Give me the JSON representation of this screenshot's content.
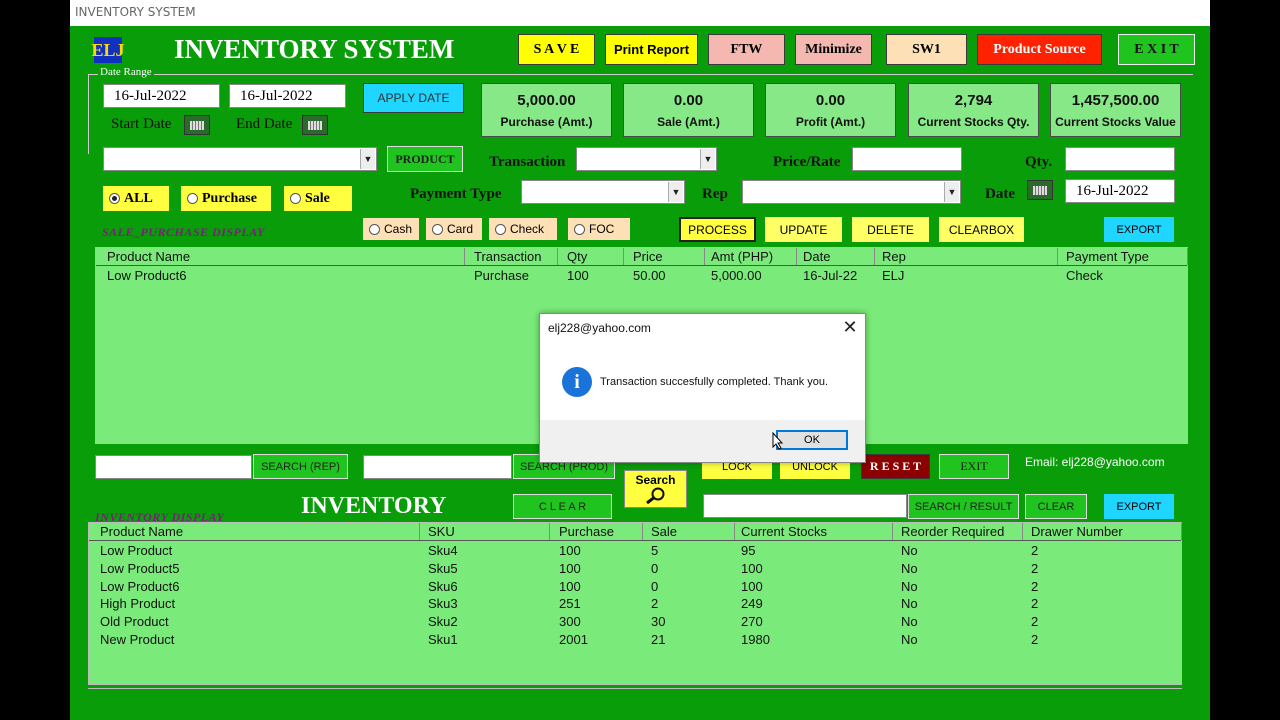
{
  "window": {
    "title": "INVENTORY SYSTEM"
  },
  "header": {
    "logo": "ELJ",
    "title": "INVENTORY SYSTEM",
    "buttons": [
      {
        "label": "S A V E",
        "color": "#ffff00"
      },
      {
        "label": "Print Report",
        "color": "#ffff00"
      },
      {
        "label": "FTW",
        "color": "#f4b8b0"
      },
      {
        "label": "Minimize",
        "color": "#f4b8b0"
      },
      {
        "label": "SW1",
        "color": "#fde0b5"
      },
      {
        "label": "Product Source",
        "color": "#ff2200"
      },
      {
        "label": "E X I T",
        "color": "#1fc41f"
      }
    ]
  },
  "date_range": {
    "legend": "Date Range",
    "start_value": "16-Jul-2022",
    "end_value": "16-Jul-2022",
    "start_label": "Start Date",
    "end_label": "End Date",
    "apply_label": "APPLY DATE"
  },
  "stats": [
    {
      "value": "5,000.00",
      "label": "Purchase (Amt.)"
    },
    {
      "value": "0.00",
      "label": "Sale (Amt.)"
    },
    {
      "value": "0.00",
      "label": "Profit (Amt.)"
    },
    {
      "value": "2,794",
      "label": "Current Stocks Qty."
    },
    {
      "value": "1,457,500.00",
      "label": "Current Stocks Value"
    }
  ],
  "form": {
    "product_button": "PRODUCT",
    "transaction_label": "Transaction",
    "price_label": "Price/Rate",
    "qty_label": "Qty.",
    "payment_type_label": "Payment Type",
    "rep_label": "Rep",
    "date_label": "Date",
    "date_value": "16-Jul-2022",
    "filters": [
      "ALL",
      "Purchase",
      "Sale"
    ],
    "payments": [
      "Cash",
      "Card",
      "Check",
      "FOC"
    ],
    "actions": [
      "PROCESS",
      "UPDATE",
      "DELETE",
      "CLEARBOX"
    ],
    "export_label": "EXPORT"
  },
  "sale_purchase": {
    "caption": "SALE_PURCHASE  DISPLAY",
    "columns": [
      "Product Name",
      "Transaction",
      "Qty",
      "Price",
      "Amt (PHP)",
      "Date",
      "Rep",
      "Payment Type"
    ],
    "rows": [
      [
        "Low Product6",
        "Purchase",
        "100",
        "50.00",
        "5,000.00",
        "16-Jul-22",
        "ELJ",
        "Check"
      ]
    ]
  },
  "search_bar": {
    "search_rep": "SEARCH (REP)",
    "search_prod": "SEARCH (PROD)",
    "lock": "LOCK",
    "unlock": "UNLOCK",
    "reset": "R E S E T",
    "exit": "EXIT",
    "email": "Email:  elj228@yahoo.com"
  },
  "inventory": {
    "caption": "INVENTORY  DISPLAY",
    "title": "INVENTORY",
    "clear_label": "C L E A R",
    "search_label": "Search",
    "search_result": "SEARCH / RESULT",
    "clear2": "CLEAR",
    "export": "EXPORT",
    "columns": [
      "Product Name",
      "SKU",
      "Purchase",
      "Sale",
      "Current Stocks",
      "Reorder Required",
      "Drawer Number"
    ],
    "rows": [
      [
        "Low Product",
        "Sku4",
        "100",
        "5",
        "95",
        "No",
        "2"
      ],
      [
        "Low Product5",
        "Sku5",
        "100",
        "0",
        "100",
        "No",
        "2"
      ],
      [
        "Low Product6",
        "Sku6",
        "100",
        "0",
        "100",
        "No",
        "2"
      ],
      [
        "High Product",
        "Sku3",
        "251",
        "2",
        "249",
        "No",
        "2"
      ],
      [
        "Old  Product",
        "Sku2",
        "300",
        "30",
        "270",
        "No",
        "2"
      ],
      [
        "New Product",
        "Sku1",
        "2001",
        "21",
        "1980",
        "No",
        "2"
      ]
    ]
  },
  "dialog": {
    "title": "elj228@yahoo.com",
    "message": "Transaction succesfully completed. Thank you.",
    "ok": "OK",
    "info_glyph": "i"
  }
}
